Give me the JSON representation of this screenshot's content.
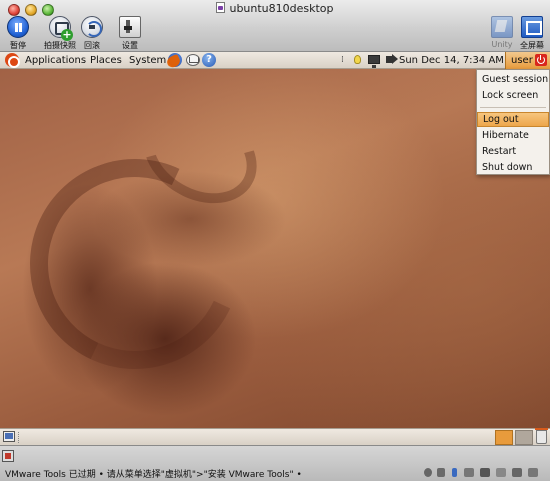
{
  "window": {
    "title": "ubuntu810desktop",
    "toolbar": {
      "pause_label": "暂停",
      "snapshot_label": "拍摄快照",
      "revert_label": "回滚",
      "settings_label": "设置",
      "unity_label": "Unity",
      "fullscreen_label": "全屏幕"
    }
  },
  "guest": {
    "top_panel": {
      "menus": [
        "Applications",
        "Places",
        "System"
      ],
      "clock": "Sun Dec 14,  7:34 AM",
      "user": "user"
    },
    "user_dropdown": {
      "items": [
        "Guest session",
        "Lock screen",
        "Log out",
        "Hibernate",
        "Restart",
        "Shut down"
      ],
      "highlighted": "Log out"
    },
    "bottom_panel": {
      "workspaces": 2,
      "active_workspace": 1
    }
  },
  "statusbar": {
    "message": "VMware Tools 已过期 • 请从菜单选择\"虚拟机\">\"安装 VMware Tools\" •"
  },
  "colors": {
    "ubuntu_orange": "#dd4814",
    "panel_bg": "#e4ddd3",
    "highlight": "#eda64b",
    "wallpaper_base": "#a16246"
  },
  "icons": [
    "pause-icon",
    "snapshot-icon",
    "revert-icon",
    "settings-icon",
    "unity-icon",
    "fullscreen-icon",
    "ubuntu-logo-icon",
    "firefox-icon",
    "mail-icon",
    "help-icon",
    "bulb-icon",
    "network-icon",
    "volume-icon",
    "power-icon",
    "show-desktop-icon",
    "trash-icon"
  ]
}
